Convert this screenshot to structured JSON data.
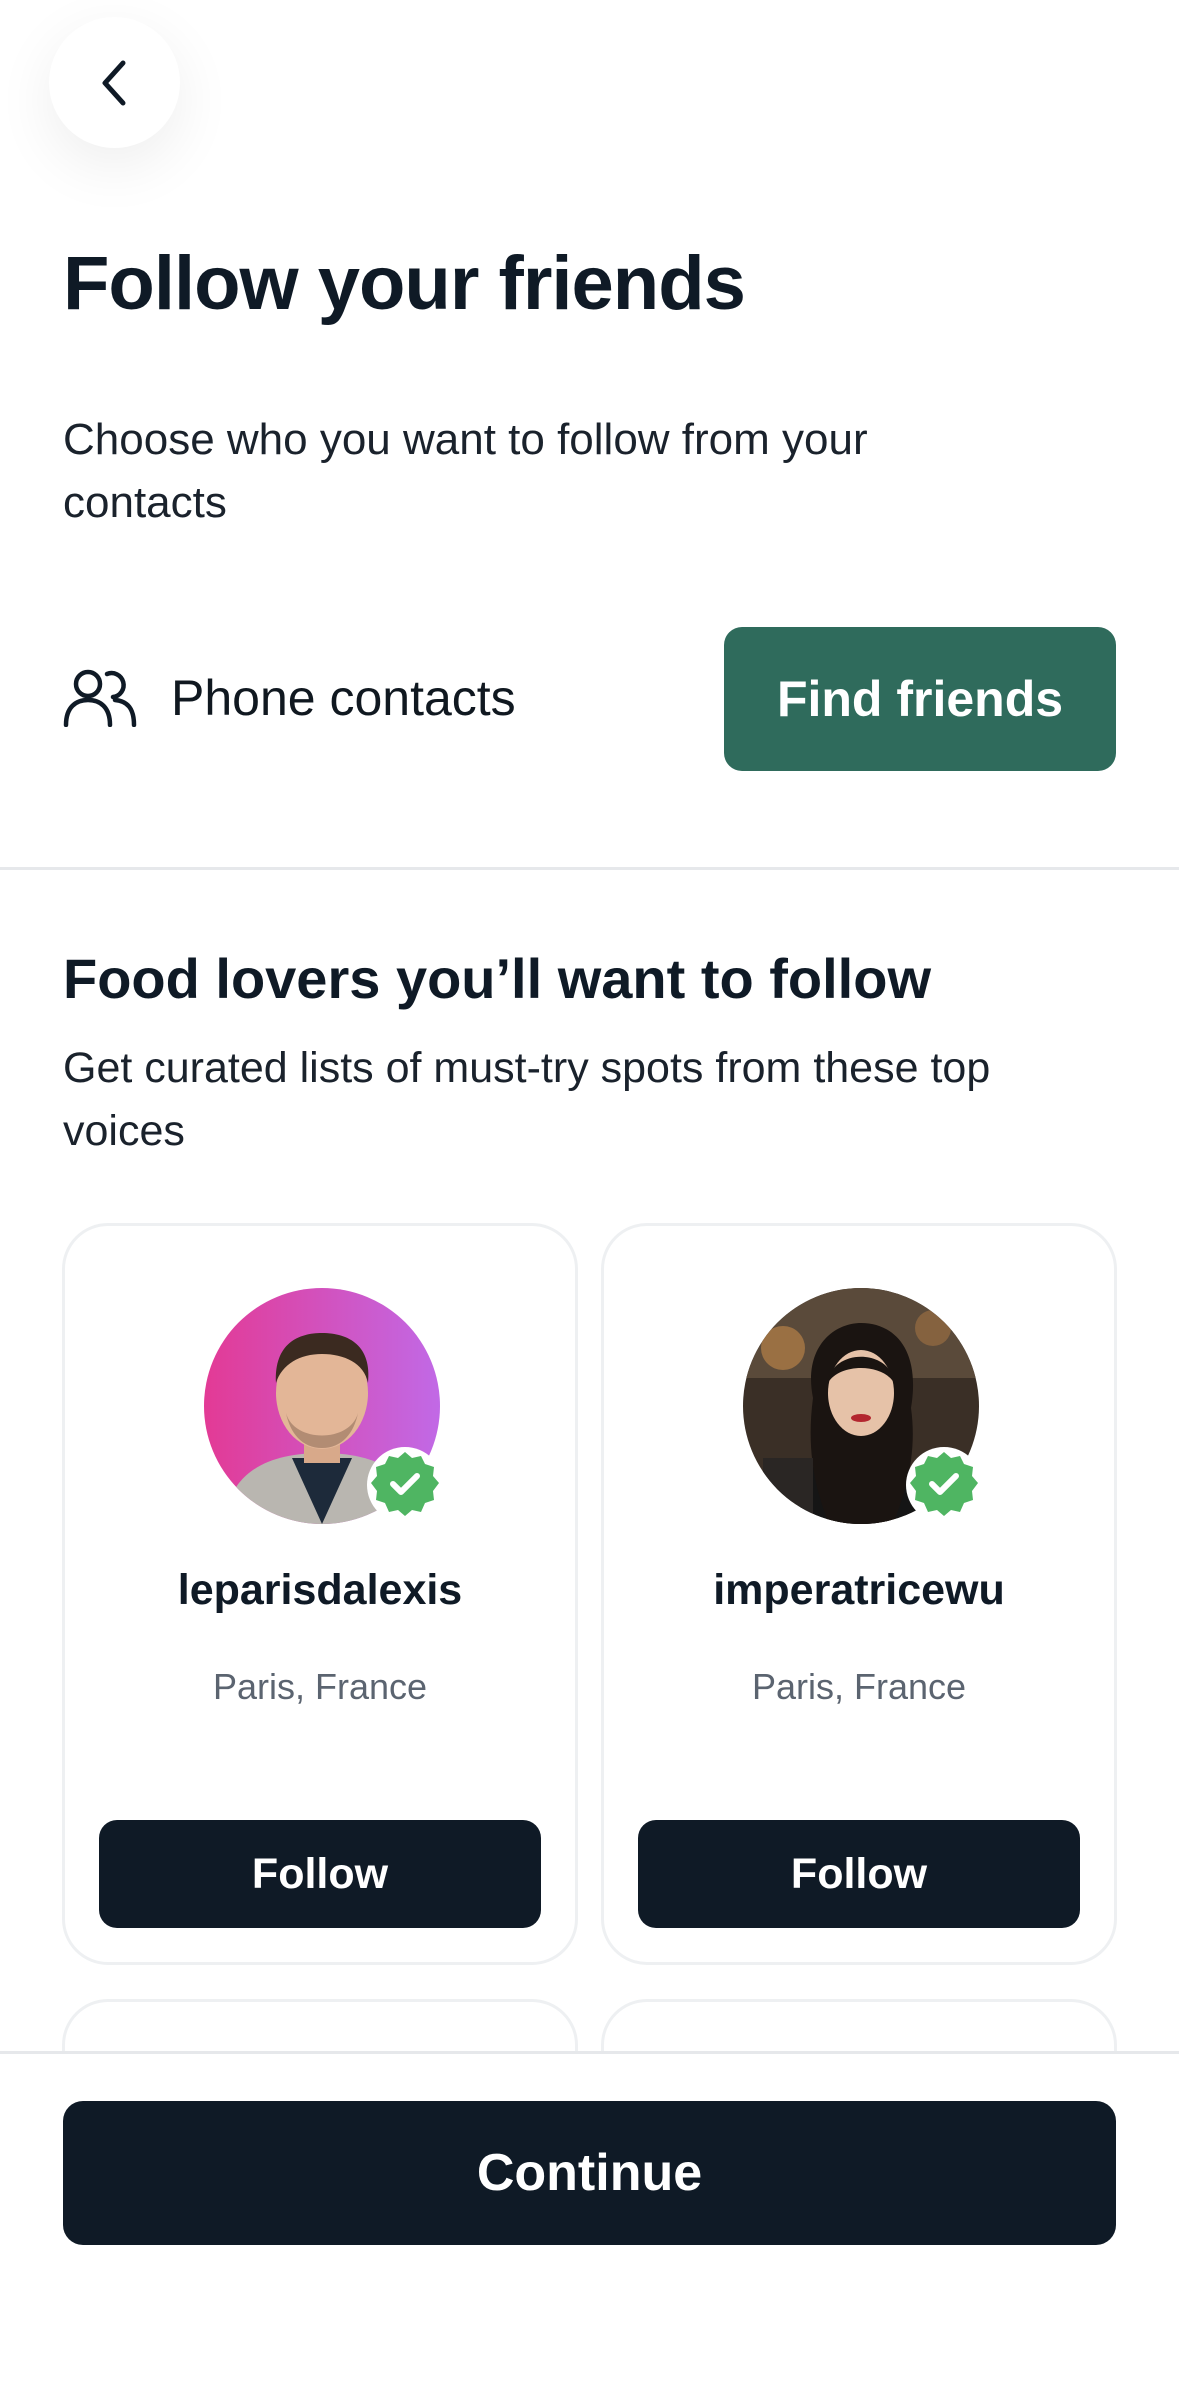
{
  "header": {
    "back_icon": "chevron-left-icon",
    "title": "Follow your friends",
    "subtitle": "Choose who you want to follow from your contacts"
  },
  "contacts": {
    "icon": "people-icon",
    "label": "Phone contacts",
    "button_label": "Find friends",
    "button_color": "#2f6b5c"
  },
  "section": {
    "title": "Food lovers you’ll want to follow",
    "subtitle": "Get curated lists of must-try spots from these top voices"
  },
  "creators": [
    {
      "username": "leparisdalexis",
      "location": "Paris, France",
      "follow_label": "Follow",
      "verified": true,
      "verified_color": "#4fb562"
    },
    {
      "username": "imperatricewu",
      "location": "Paris, France",
      "follow_label": "Follow",
      "verified": true,
      "verified_color": "#4fb562"
    }
  ],
  "footer": {
    "continue_label": "Continue",
    "button_color": "#0f1a26"
  }
}
